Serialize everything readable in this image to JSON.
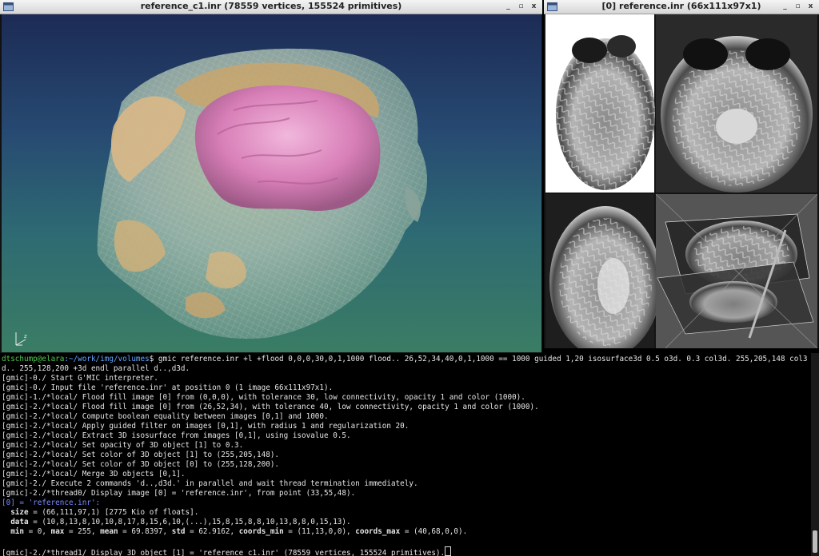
{
  "window3d": {
    "title": "reference_c1.inr (78559 vertices, 155524 primitives)",
    "controls": [
      "_",
      "▫",
      "x"
    ],
    "axis_labels": {
      "x": "x",
      "y": "y",
      "z": "z"
    }
  },
  "windowSlices": {
    "title": "[0] reference.inr (66x111x97x1)",
    "controls": [
      "_",
      "▫",
      "x"
    ]
  },
  "terminal": {
    "prompt_user": "dtschump@elara",
    "prompt_path": ":~/work/img/volumes",
    "command": "$ gmic reference.inr +l +flood 0,0,0,30,0,1,1000 flood.. 26,52,34,40,0,1,1000 == 1000 guided 1,20 isosurface3d 0.5 o3d. 0.3 col3d. 255,205,148 col3",
    "command_cont": "d.. 255,128,200 +3d endl parallel d..,d3d.",
    "log": [
      "[gmic]-0./ Start G'MIC interpreter.",
      "[gmic]-0./ Input file 'reference.inr' at position 0 (1 image 66x111x97x1).",
      "[gmic]-1./*local/ Flood fill image [0] from (0,0,0), with tolerance 30, low connectivity, opacity 1 and color (1000).",
      "[gmic]-2./*local/ Flood fill image [0] from (26,52,34), with tolerance 40, low connectivity, opacity 1 and color (1000).",
      "[gmic]-2./*local/ Compute boolean equality between images [0,1] and 1000.",
      "[gmic]-2./*local/ Apply guided filter on images [0,1], with radius 1 and regularization 20.",
      "[gmic]-2./*local/ Extract 3D isosurface from images [0,1], using isovalue 0.5.",
      "[gmic]-2./*local/ Set opacity of 3D object [1] to 0.3.",
      "[gmic]-2./*local/ Set color of 3D object [1] to (255,205,148).",
      "[gmic]-2./*local/ Set color of 3D object [0] to (255,128,200).",
      "[gmic]-2./*local/ Merge 3D objects [0,1].",
      "[gmic]-2./ Execute 2 commands 'd..,d3d.' in parallel and wait thread termination immediately.",
      "[gmic]-2./*thread0/ Display image [0] = 'reference.inr', from point (33,55,48)."
    ],
    "image_header": "[0] = 'reference.inr':",
    "size_key": "size",
    "size_val": " = (66,111,97,1) [2775 Kio of floats].",
    "data_key": "data",
    "data_val": " = (10,8,13,8,10,10,8,17,8,15,6,10,(...),15,8,15,8,8,10,13,8,8,0,15,13).",
    "stats": [
      {
        "k": "min",
        "v": " = 0, "
      },
      {
        "k": "max",
        "v": " = 255, "
      },
      {
        "k": "mean",
        "v": " = 69.8397, "
      },
      {
        "k": "std",
        "v": " = 62.9162, "
      },
      {
        "k": "coords_min",
        "v": " = (11,13,0,0), "
      },
      {
        "k": "coords_max",
        "v": " = (40,68,0,0)."
      }
    ],
    "last_line": "[gmic]-2./*thread1/ Display 3D object [1] = 'reference_c1.inr' (78559 vertices, 155524 primitives)."
  },
  "colors": {
    "prompt": "#4ec94e",
    "path": "#5fa8ff",
    "surface_outer": "#e8c893",
    "surface_inner": "#e58fc4"
  }
}
